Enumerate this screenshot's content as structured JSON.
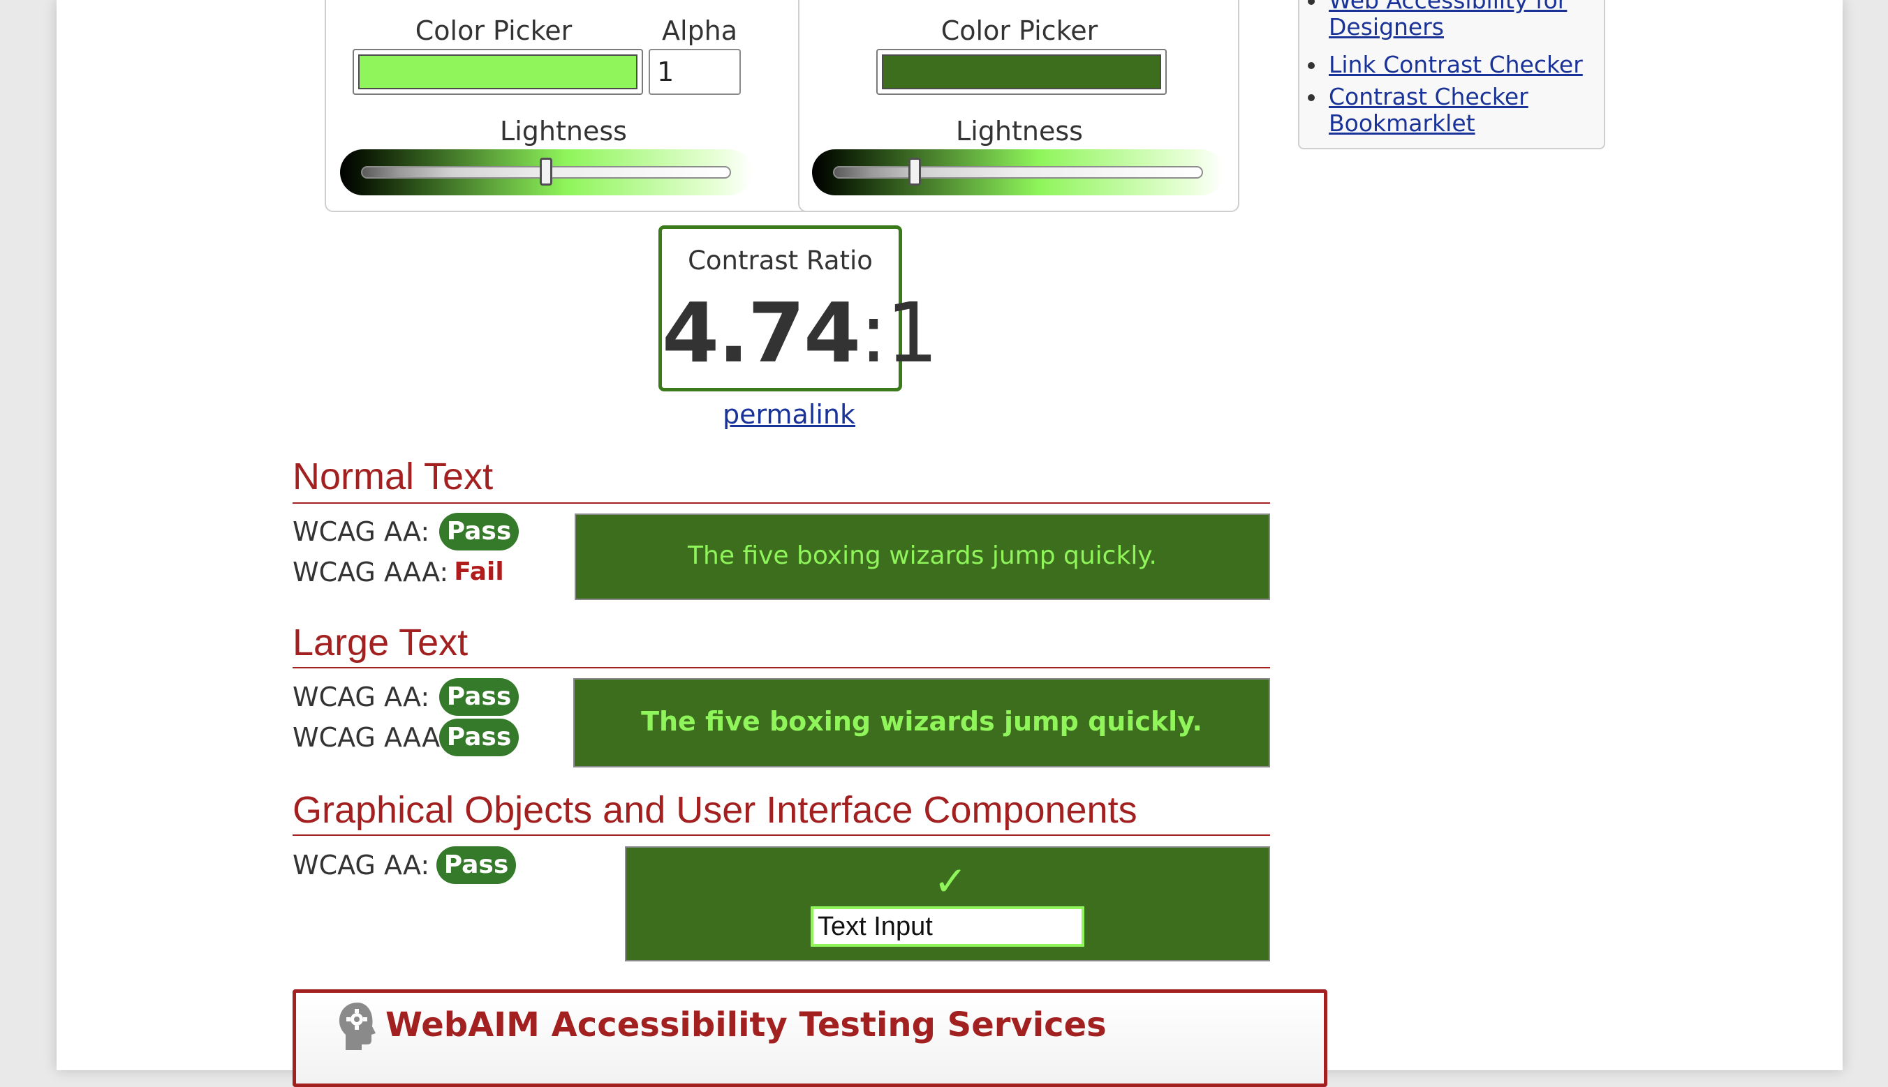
{
  "foreground": {
    "picker_label": "Color Picker",
    "alpha_label": "Alpha",
    "alpha_value": "1",
    "lightness_label": "Lightness",
    "swatch_color": "#8ff55b",
    "lightness_percent": 50
  },
  "background": {
    "picker_label": "Color Picker",
    "lightness_label": "Lightness",
    "swatch_color": "#3d6e1e",
    "lightness_percent": 22
  },
  "contrast": {
    "title": "Contrast Ratio",
    "value": "4.74",
    "colon": ":",
    "suffix": "1",
    "permalink": "permalink"
  },
  "normal_text": {
    "heading": "Normal Text",
    "aa_label": "WCAG AA:",
    "aa_result": "Pass",
    "aaa_label": "WCAG AAA:",
    "aaa_result": "Fail",
    "sample": "The five boxing wizards jump quickly."
  },
  "large_text": {
    "heading": "Large Text",
    "aa_label": "WCAG AA:",
    "aa_result": "Pass",
    "aaa_label": "WCAG AAA:",
    "aaa_result": "Pass",
    "sample": "The five boxing wizards jump quickly."
  },
  "graphical": {
    "heading": "Graphical Objects and User Interface Components",
    "aa_label": "WCAG AA:",
    "aa_result": "Pass",
    "check_glyph": "✓",
    "input_value": "Text Input"
  },
  "services": {
    "title": "WebAIM Accessibility Testing Services"
  },
  "sidebar": {
    "links": [
      {
        "line1": "Web Accessibility for",
        "line2": "Designers"
      },
      {
        "line1": "Link Contrast Checker",
        "line2": ""
      },
      {
        "line1": "Contrast Checker",
        "line2": "Bookmarklet"
      }
    ]
  },
  "colors": {
    "heading_red": "#a32020",
    "pass_green": "#357a2a",
    "link_blue": "#1a3399"
  }
}
